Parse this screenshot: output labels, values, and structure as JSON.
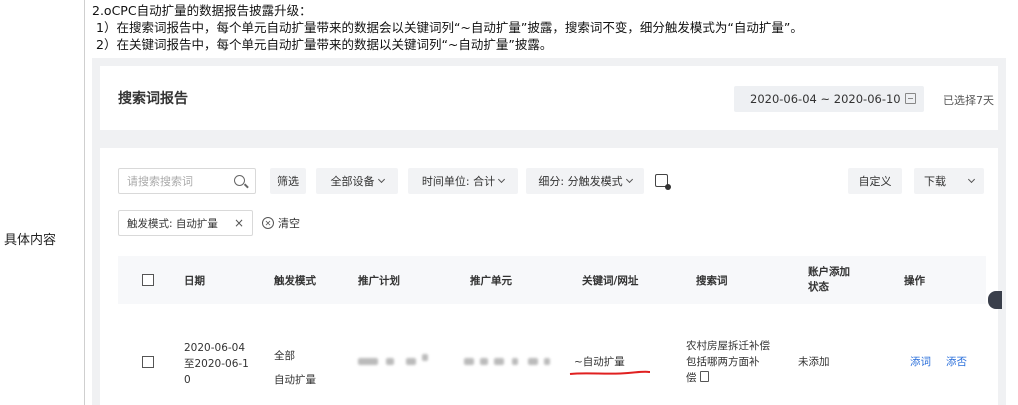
{
  "document": {
    "row_label": "具体内容",
    "notes": [
      "2.oCPC自动扩量的数据报告披露升级：",
      "1）在搜索词报告中，每个单元自动扩量带来的数据会以关键词列“~自动扩量”披露，搜索词不变，细分触发模式为“自动扩量”。",
      "2）在关键词报告中，每个单元自动扩量带来的数据以关键词列“~自动扩量”披露。"
    ]
  },
  "report": {
    "title": "搜索词报告",
    "date_range": "2020-06-04 ~ 2020-06-10",
    "selected_days": "已选择7天",
    "search": {
      "placeholder": "请搜索搜索词",
      "value": ""
    },
    "toolbar": {
      "filter": "筛选",
      "device": "全部设备",
      "time_unit": "时间单位: 合计",
      "breakdown": "细分: 分触发模式",
      "customize": "自定义",
      "download": "下载"
    },
    "active_filter": {
      "label": "触发模式: 自动扩量",
      "close": "×"
    },
    "clear_label": "清空",
    "columns": [
      "日期",
      "触发模式",
      "推广计划",
      "推广单元",
      "关键词/网址",
      "搜索词",
      "账户添加状态",
      "操作"
    ],
    "columns_wrapped": {
      "account_status_line1": "账户添加",
      "account_status_line2": "状态"
    },
    "rows": [
      {
        "date_lines": [
          "2020-06-04",
          "至2020-06-1",
          "0"
        ],
        "trigger_lines": [
          "全部",
          "自动扩量"
        ],
        "keyword": "~自动扩量",
        "search_term_lines": [
          "农村房屋拆迁补偿",
          "包括哪两方面补",
          "偿"
        ],
        "status": "未添加",
        "actions": [
          "添词",
          "添否"
        ]
      }
    ]
  },
  "colors": {
    "link": "#2a6fdb",
    "underline": "#e02020",
    "panel_bg": "#f0f1f3"
  }
}
